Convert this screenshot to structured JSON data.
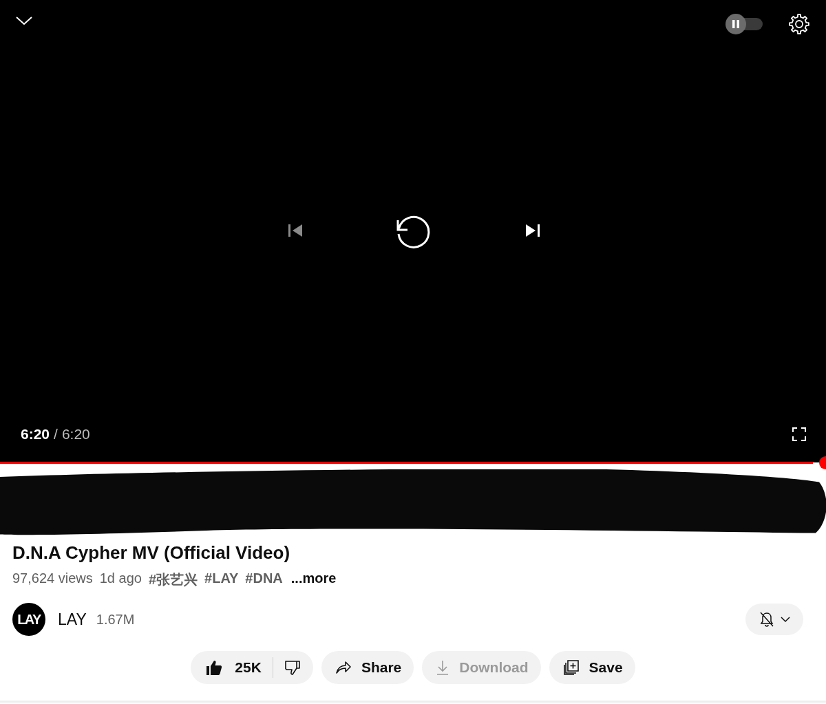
{
  "player": {
    "autoplay": {
      "on": false
    },
    "previous": {
      "disabled": true
    },
    "time_current": "6:20",
    "time_separator": "/",
    "time_total": "6:20",
    "progress": {
      "level": 1
    }
  },
  "video": {
    "title": "D.N.A Cypher MV (Official Video)",
    "views": "97,624 views",
    "age": "1d ago",
    "hashtags": [
      "#张艺兴",
      "#LAY",
      "#DNA"
    ],
    "more": "...more"
  },
  "channel": {
    "avatar_text": "LAY",
    "name": "LAY",
    "subscribers": "1.67M"
  },
  "actions": [
    {
      "kind": "like",
      "label": "25K"
    },
    {
      "kind": "share",
      "label": "Share",
      "disabled": false
    },
    {
      "kind": "download",
      "label": "Download",
      "disabled": true
    },
    {
      "kind": "save",
      "label": "Save",
      "disabled": false
    }
  ]
}
